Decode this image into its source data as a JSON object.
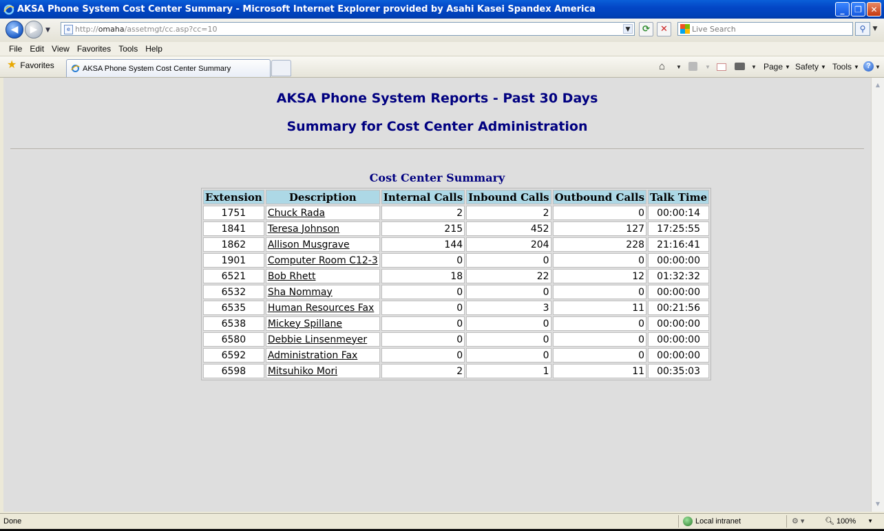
{
  "window": {
    "title": "AKSA Phone System Cost Center Summary - Microsoft Internet Explorer provided by Asahi Kasei Spandex America",
    "minimize_glyph": "_",
    "maximize_glyph": "❐",
    "close_glyph": "✕"
  },
  "address_bar": {
    "url_prefix": "http://",
    "url_domain": "omaha",
    "url_path": "/assetmgt/cc.asp?cc=10",
    "search_placeholder": "Live Search"
  },
  "menu": [
    "File",
    "Edit",
    "View",
    "Favorites",
    "Tools",
    "Help"
  ],
  "tabs": {
    "favorites_label": "Favorites",
    "active_tab_label": "AKSA Phone System Cost Center Summary"
  },
  "command_bar": {
    "page_label": "Page",
    "safety_label": "Safety",
    "tools_label": "Tools"
  },
  "page": {
    "heading": "AKSA Phone System Reports - Past 30 Days",
    "subheading": "Summary for Cost Center Administration",
    "table_caption": "Cost Center Summary",
    "columns": [
      "Extension",
      "Description",
      "Internal Calls",
      "Inbound Calls",
      "Outbound Calls",
      "Talk Time"
    ],
    "rows": [
      {
        "extension": "1751",
        "description": "Chuck Rada",
        "internal": "2",
        "inbound": "2",
        "outbound": "0",
        "talk_time": "00:00:14"
      },
      {
        "extension": "1841",
        "description": "Teresa Johnson",
        "internal": "215",
        "inbound": "452",
        "outbound": "127",
        "talk_time": "17:25:55"
      },
      {
        "extension": "1862",
        "description": "Allison Musgrave",
        "internal": "144",
        "inbound": "204",
        "outbound": "228",
        "talk_time": "21:16:41"
      },
      {
        "extension": "1901",
        "description": "Computer Room C12-3",
        "internal": "0",
        "inbound": "0",
        "outbound": "0",
        "talk_time": "00:00:00"
      },
      {
        "extension": "6521",
        "description": "Bob Rhett",
        "internal": "18",
        "inbound": "22",
        "outbound": "12",
        "talk_time": "01:32:32"
      },
      {
        "extension": "6532",
        "description": "Sha Nommay",
        "internal": "0",
        "inbound": "0",
        "outbound": "0",
        "talk_time": "00:00:00"
      },
      {
        "extension": "6535",
        "description": "Human Resources Fax",
        "internal": "0",
        "inbound": "3",
        "outbound": "11",
        "talk_time": "00:21:56"
      },
      {
        "extension": "6538",
        "description": "Mickey Spillane",
        "internal": "0",
        "inbound": "0",
        "outbound": "0",
        "talk_time": "00:00:00"
      },
      {
        "extension": "6580",
        "description": "Debbie Linsenmeyer",
        "internal": "0",
        "inbound": "0",
        "outbound": "0",
        "talk_time": "00:00:00"
      },
      {
        "extension": "6592",
        "description": "Administration Fax",
        "internal": "0",
        "inbound": "0",
        "outbound": "0",
        "talk_time": "00:00:00"
      },
      {
        "extension": "6598",
        "description": "Mitsuhiko Mori",
        "internal": "2",
        "inbound": "1",
        "outbound": "11",
        "talk_time": "00:35:03"
      }
    ]
  },
  "status_bar": {
    "status_text": "Done",
    "zone_text": "Local intranet",
    "zoom_text": "100%"
  },
  "icons": {
    "back": "back-arrow-icon",
    "forward": "forward-arrow-icon",
    "refresh": "refresh-icon",
    "stop": "stop-icon",
    "search": "magnifier-icon",
    "home": "home-icon",
    "feeds": "rss-feed-icon",
    "mail": "mail-icon",
    "print": "printer-icon",
    "help": "help-icon"
  },
  "colors": {
    "heading": "#000080",
    "header_cell": "#add8e6",
    "page_background": "#dedede",
    "titlebar": "#0346c6"
  }
}
